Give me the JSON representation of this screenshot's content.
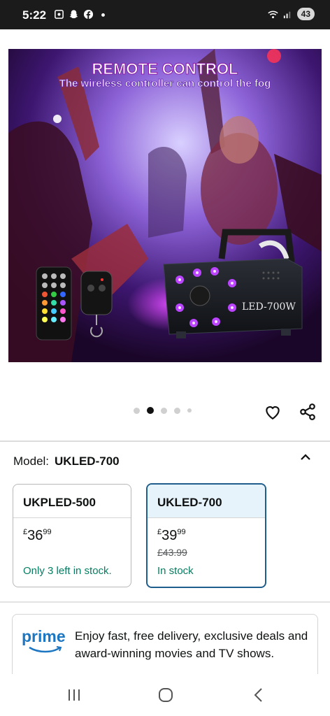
{
  "status_bar": {
    "time": "5:22",
    "battery": "43",
    "icons": [
      "screenshot-icon",
      "snapchat-icon",
      "facebook-icon",
      "notification-dot-icon",
      "wifi-icon",
      "signal-icon"
    ]
  },
  "hero": {
    "title": "REMOTE CONTROL",
    "subtitle": "The wireless controller can control the fog",
    "device_label": "LED-700W"
  },
  "carousel": {
    "count": 5,
    "active_index": 1
  },
  "model": {
    "label": "Model:",
    "value": "UKLED-700"
  },
  "options": [
    {
      "name": "UKPLED-500",
      "currency": "£",
      "whole": "36",
      "fraction": "99",
      "was": "",
      "stock": "Only 3 left in stock.",
      "selected": false
    },
    {
      "name": "UKLED-700",
      "currency": "£",
      "whole": "39",
      "fraction": "99",
      "was": "£43.99",
      "stock": "In stock",
      "selected": true
    }
  ],
  "prime": {
    "logo": "prime",
    "text": "Enjoy fast, free delivery, exclusive deals and award-winning movies and TV shows."
  },
  "colors": {
    "stock_green": "#067d62",
    "prime_blue": "#1c76c2",
    "selected_border": "#1f5e8c"
  }
}
